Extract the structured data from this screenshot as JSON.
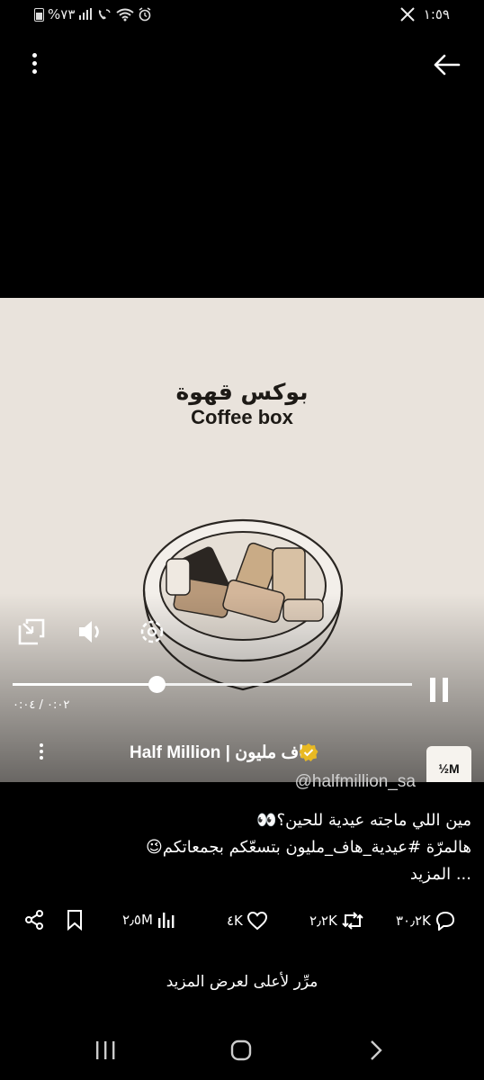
{
  "status_bar": {
    "battery": "%٧٣",
    "time": "١:٥٩"
  },
  "video": {
    "title_ar": "بوكس قهوة",
    "title_en": "Coffee box",
    "time_display": "٠:٠٢ / ٠:٠٤",
    "progress": 0.36
  },
  "author": {
    "name": "Half Million | هاف مليون",
    "handle": "@halfmillion_sa",
    "logo_text": "½M"
  },
  "tweet": {
    "line1": "مين اللي ماجته عيدية للحين؟👀",
    "line2": "هالمرّة #عيدية_هاف_مليون بتسعّكم بجمعاتكم😉",
    "more": "... المزيد"
  },
  "actions": {
    "views": "٢٫٥M",
    "likes": "٤K",
    "reposts": "٢٫٢K",
    "replies": "٣٠٫٢K"
  },
  "hint": "مرِّر لأعلى لعرض المزيد",
  "colors": {
    "background": "#000000",
    "video_bg": "#e9e3dc",
    "verified_badge": "#e8b923"
  }
}
